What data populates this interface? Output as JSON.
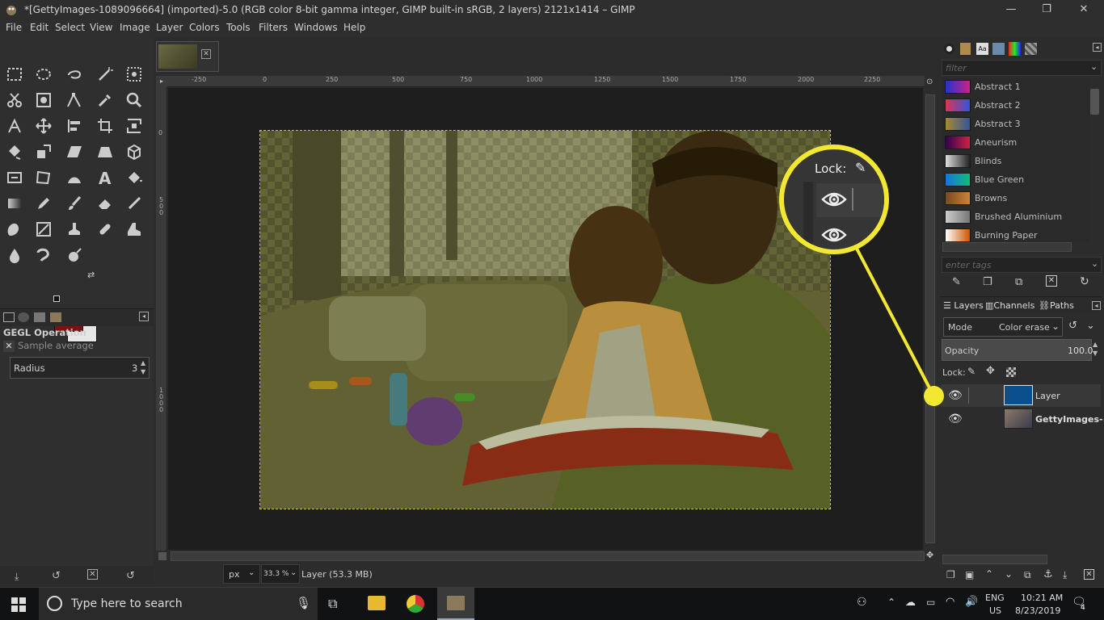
{
  "window": {
    "title": "*[GettyImages-1089096664] (imported)-5.0 (RGB color 8-bit gamma integer, GIMP built-in sRGB, 2 layers) 2121x1414 – GIMP",
    "minimize": "—",
    "maximize": "❐",
    "close": "✕"
  },
  "menu": [
    "File",
    "Edit",
    "Select",
    "View",
    "Image",
    "Layer",
    "Colors",
    "Tools",
    "Filters",
    "Windows",
    "Help"
  ],
  "toolbox": {
    "fg_color": "#7b1313",
    "bg_color": "#e6e6e6",
    "tool_options_title": "GEGL Operation",
    "sample_average": "Sample average",
    "radius_label": "Radius",
    "radius_value": "3"
  },
  "canvas": {
    "ruler_ticks": [
      "-250",
      "0",
      "250",
      "500",
      "750",
      "1000",
      "1250",
      "1500",
      "1750",
      "2000",
      "2250"
    ],
    "vruler_ticks": [
      "0",
      "5 0 0",
      "1 0 0 0"
    ],
    "unit": "px",
    "zoom": "33.3 %",
    "status": "Layer (53.3 MB)"
  },
  "gradients": {
    "filter_placeholder": "filter",
    "tags_placeholder": "enter tags",
    "items": [
      {
        "name": "Abstract 1",
        "c1": "#2233cc",
        "c2": "#cc2288"
      },
      {
        "name": "Abstract 2",
        "c1": "#dd3355",
        "c2": "#3355dd"
      },
      {
        "name": "Abstract 3",
        "c1": "#aa8833",
        "c2": "#335599"
      },
      {
        "name": "Aneurism",
        "c1": "#330055",
        "c2": "#cc2244"
      },
      {
        "name": "Blinds",
        "c1": "#dddddd",
        "c2": "#222222"
      },
      {
        "name": "Blue Green",
        "c1": "#1177dd",
        "c2": "#11bb77"
      },
      {
        "name": "Browns",
        "c1": "#7a4a1e",
        "c2": "#c8843a"
      },
      {
        "name": "Brushed Aluminium",
        "c1": "#cccccc",
        "c2": "#777777"
      },
      {
        "name": "Burning Paper",
        "c1": "#ffffff",
        "c2": "#cc5500"
      }
    ]
  },
  "layers_panel": {
    "tabs": [
      "Layers",
      "Channels",
      "Paths"
    ],
    "mode_label": "Mode",
    "mode_value": "Color erase",
    "opacity_label": "Opacity",
    "opacity_value": "100.0",
    "lock_label": "Lock:",
    "layers": [
      {
        "name": "Layer",
        "thumb_color": "#0b4f8c"
      },
      {
        "name": "GettyImages-"
      }
    ]
  },
  "callout": {
    "lock_label": "Lock:",
    "highlight_color": "#f2e831"
  },
  "taskbar": {
    "search_placeholder": "Type here to search",
    "lang1": "ENG",
    "lang2": "US",
    "time": "10:21 AM",
    "date": "8/23/2019",
    "notif_count": "4"
  }
}
